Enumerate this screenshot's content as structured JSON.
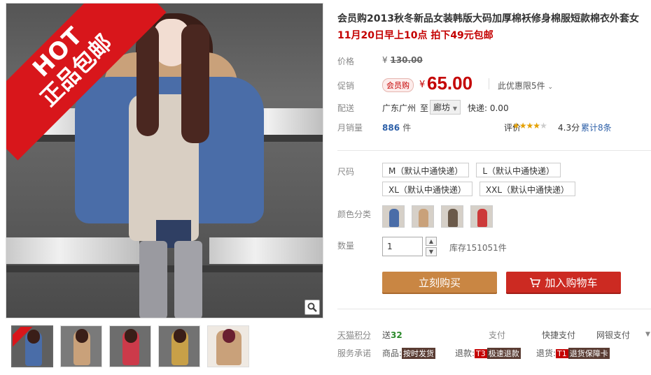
{
  "gallery": {
    "ribbon_hot": "HOT",
    "ribbon_free": "正品包邮",
    "zoom_icon": "magnifier-icon",
    "thumbnail_count": 5
  },
  "product": {
    "title": "会员购2013秋冬新品女装韩版大码加厚棉袄修身棉服短款棉衣外套女",
    "subtitle": "11月20日早上10点 拍下49元包邮"
  },
  "price": {
    "orig_label": "价格",
    "orig_currency": "¥",
    "orig_value": "130.00",
    "promo_label": "促销",
    "member_tag": "会员购",
    "promo_currency": "¥",
    "promo_value": "65.00",
    "promo_note": "此优惠限5件",
    "promo_note_icon": "chevron-down-icon"
  },
  "shipping": {
    "label": "配送",
    "from": "广东广州",
    "to_label": "至",
    "to_city": "廊坊",
    "fee": "快递: 0.00"
  },
  "sales": {
    "label": "月销量",
    "count": "886",
    "unit": "件",
    "rating_label": "评价",
    "rating_stars": 4.3,
    "rating_score": "4.3分",
    "rating_count": "累计8条"
  },
  "sizes": {
    "label": "尺码",
    "options": [
      "M（默认中通快递）",
      "L（默认中通快递）",
      "XL（默认中通快递）",
      "XXL（默认中通快递）"
    ]
  },
  "colors": {
    "label": "颜色分类",
    "swatches": [
      "#4a6da8",
      "#c9a17a",
      "#6b5a4a",
      "#cc3a3a"
    ]
  },
  "quantity": {
    "label": "数量",
    "value": "1",
    "stock": "库存151051件"
  },
  "actions": {
    "buy_now": "立刻购买",
    "add_to_cart": "加入购物车"
  },
  "payment": {
    "points_label": "天猫积分",
    "points_prefix": "送",
    "points_value": "32",
    "pay_label": "支付",
    "pay_fast": "快捷支付",
    "pay_bank": "网银支付"
  },
  "services": {
    "label": "服务承诺",
    "goods_prefix": "商品:",
    "goods_badge": "按时发货",
    "refund_prefix": "退款:",
    "refund_tag": "T3",
    "refund_badge": "极速退款",
    "return_prefix": "退货:",
    "return_tag": "T1",
    "return_badge": "退货保障卡"
  },
  "colors_theme": {
    "price_red": "#c40000",
    "buy_orange": "#c98643",
    "cart_red": "#cc2a22",
    "link_blue": "#2c5fa8"
  }
}
